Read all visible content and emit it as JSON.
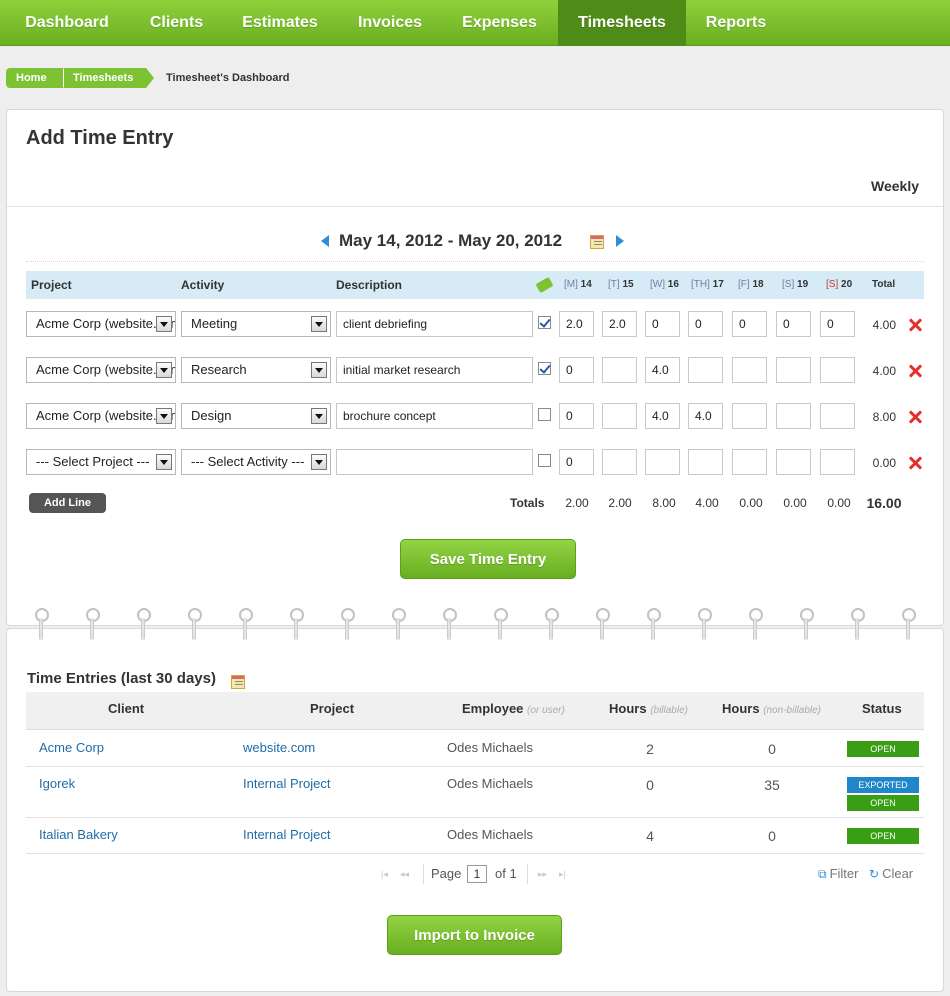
{
  "nav": {
    "tabs": [
      {
        "label": "Dashboard"
      },
      {
        "label": "Clients"
      },
      {
        "label": "Estimates"
      },
      {
        "label": "Invoices"
      },
      {
        "label": "Expenses"
      },
      {
        "label": "Timesheets",
        "active": true
      },
      {
        "label": "Reports"
      }
    ]
  },
  "breadcrumb": {
    "home": "Home",
    "section": "Timesheets",
    "current": "Timesheet's Dashboard"
  },
  "entry": {
    "title": "Add Time Entry",
    "view_mode": "Weekly",
    "date_range": "May 14, 2012  - May 20, 2012",
    "columns": {
      "project": "Project",
      "activity": "Activity",
      "description": "Description",
      "total": "Total"
    },
    "days": [
      {
        "abbr": "[M]",
        "day": "14"
      },
      {
        "abbr": "[T]",
        "day": "15"
      },
      {
        "abbr": "[W]",
        "day": "16"
      },
      {
        "abbr": "[TH]",
        "day": "17"
      },
      {
        "abbr": "[F]",
        "day": "18"
      },
      {
        "abbr": "[S]",
        "day": "19"
      },
      {
        "abbr": "[S]",
        "day": "20"
      }
    ],
    "rows": [
      {
        "project": "Acme Corp (website.com)",
        "activity": "Meeting",
        "description": "client debriefing",
        "billable": true,
        "hours": [
          "2.0",
          "2.0",
          "0",
          "0",
          "0",
          "0",
          "0"
        ],
        "total": "4.00"
      },
      {
        "project": "Acme Corp (website.com)",
        "activity": "Research",
        "description": "initial market research",
        "billable": true,
        "hours": [
          "0",
          "",
          "4.0",
          "",
          "",
          "",
          ""
        ],
        "total": "4.00"
      },
      {
        "project": "Acme Corp (website.com)",
        "activity": "Design",
        "description": "brochure concept",
        "billable": false,
        "hours": [
          "0",
          "",
          "4.0",
          "4.0",
          "",
          "",
          ""
        ],
        "total": "8.00"
      },
      {
        "project": "--- Select Project ---",
        "activity": "--- Select Activity ---",
        "description": "",
        "billable": false,
        "hours": [
          "0",
          "",
          "",
          "",
          "",
          "",
          ""
        ],
        "total": "0.00"
      }
    ],
    "add_line_label": "Add Line",
    "totals_label": "Totals",
    "totals": [
      "2.00",
      "2.00",
      "8.00",
      "4.00",
      "0.00",
      "0.00",
      "0.00"
    ],
    "grand_total": "16.00",
    "save_label": "Save Time Entry"
  },
  "entries": {
    "title": "Time Entries (last 30 days)",
    "headers": {
      "client": "Client",
      "project": "Project",
      "employee": "Employee",
      "employee_sub": "(or user)",
      "hours_billable": "Hours",
      "hours_billable_sub": "(billable)",
      "hours_nonbillable": "Hours",
      "hours_nonbillable_sub": "(non-billable)",
      "status": "Status"
    },
    "rows": [
      {
        "client": "Acme Corp",
        "project": "website.com",
        "employee": "Odes Michaels",
        "billable": "2",
        "nonbillable": "0",
        "status": [
          "OPEN"
        ]
      },
      {
        "client": "Igorek",
        "project": "Internal Project",
        "employee": "Odes Michaels",
        "billable": "0",
        "nonbillable": "35",
        "status": [
          "EXPORTED",
          "OPEN"
        ]
      },
      {
        "client": "Italian Bakery",
        "project": "Internal Project",
        "employee": "Odes Michaels",
        "billable": "4",
        "nonbillable": "0",
        "status": [
          "OPEN"
        ]
      }
    ],
    "pager": {
      "page_label": "Page",
      "page": "1",
      "of_label": "of 1"
    },
    "filter_label": "Filter",
    "clear_label": "Clear",
    "import_label": "Import to Invoice"
  },
  "colors": {
    "nav_green": "#7cc233",
    "nav_active": "#4f8c17",
    "header_blue": "#d6ebf6",
    "link_blue": "#1f6da8",
    "status_open": "#3a9e14",
    "status_exported": "#1f86c9",
    "delete_red": "#e3322b"
  }
}
